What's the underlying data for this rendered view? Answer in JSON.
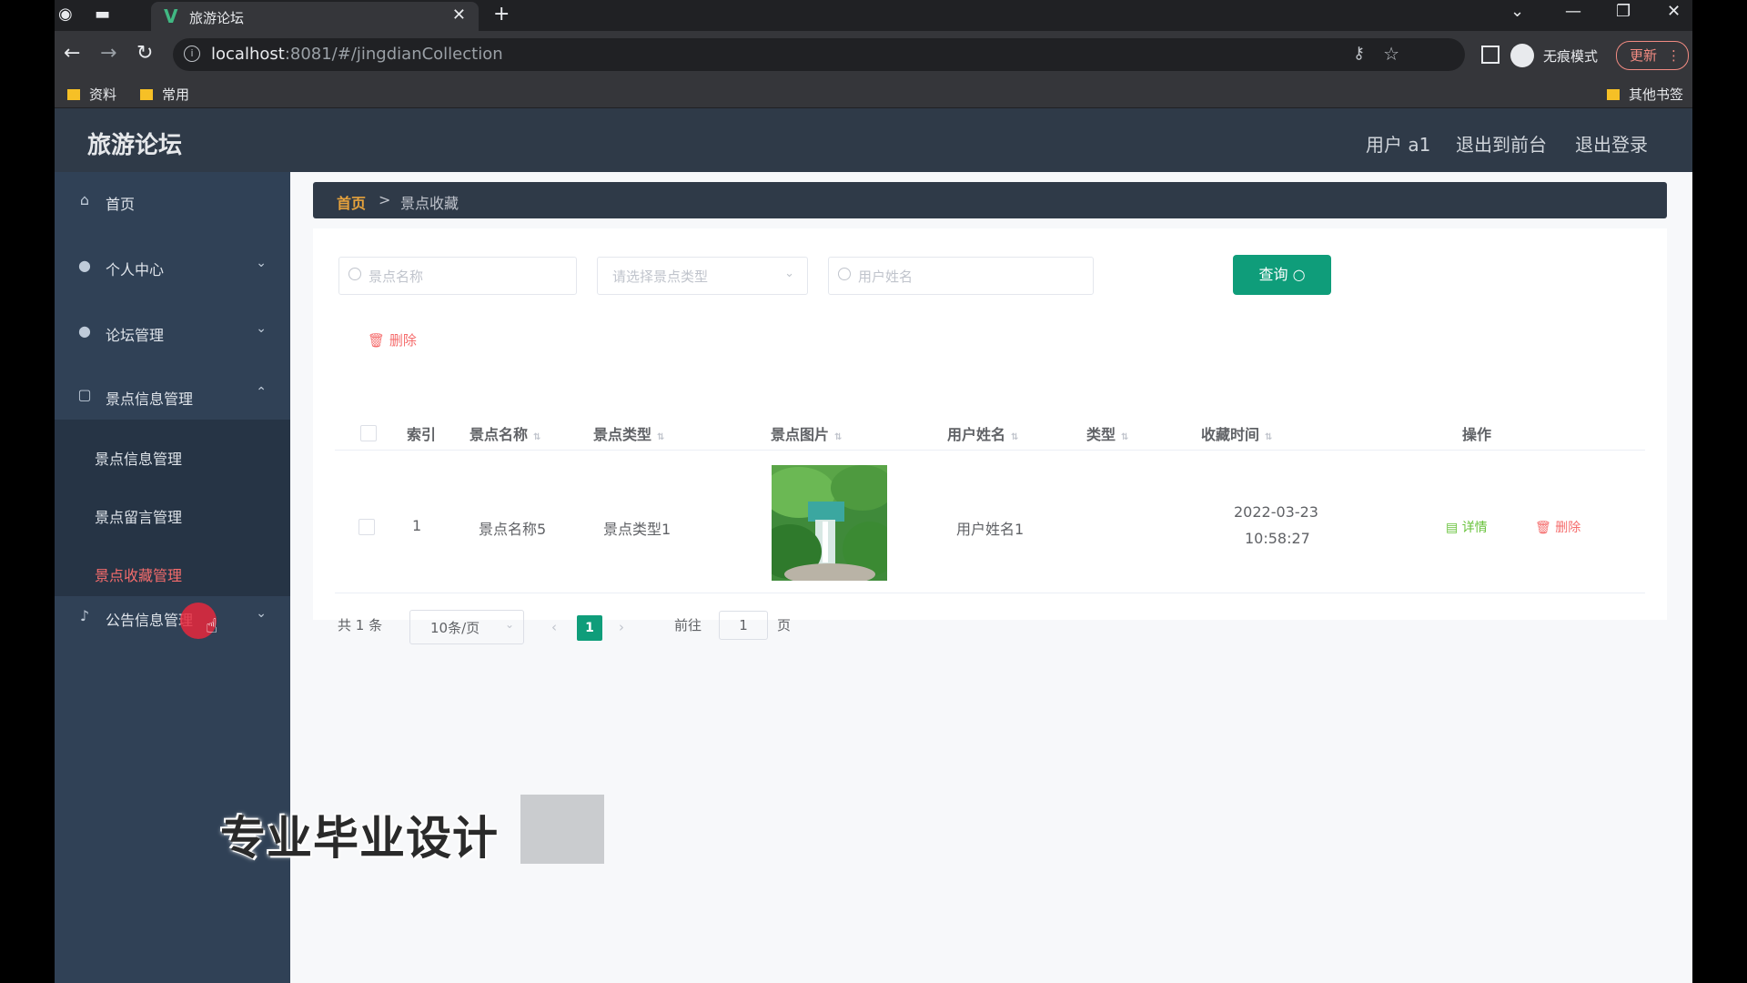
{
  "browser": {
    "tab_title": "旅游论坛",
    "url_host": "localhost",
    "url_rest": ":8081/#/jingdianCollection",
    "incognito_label": "无痕模式",
    "update_label": "更新",
    "bookmarks": [
      "资料",
      "常用"
    ],
    "other_bookmarks": "其他书签"
  },
  "app": {
    "title": "旅游论坛",
    "header_links": [
      "用户 a1",
      "退出到前台",
      "退出登录"
    ]
  },
  "sidebar": {
    "items": [
      {
        "label": "首页",
        "icon": "home-icon"
      },
      {
        "label": "个人中心",
        "icon": "user-icon"
      },
      {
        "label": "论坛管理",
        "icon": "user-icon"
      },
      {
        "label": "景点信息管理",
        "icon": "document-icon"
      },
      {
        "label": "公告信息管理",
        "icon": "microphone-icon"
      }
    ],
    "sub_items": [
      "景点信息管理",
      "景点留言管理",
      "景点收藏管理"
    ],
    "active_sub": "景点收藏管理"
  },
  "breadcrumb": {
    "home": "首页",
    "sep": ">",
    "current": "景点收藏"
  },
  "search": {
    "name_placeholder": "景点名称",
    "type_placeholder": "请选择景点类型",
    "user_placeholder": "用户姓名",
    "query_label": "查询"
  },
  "toolbar": {
    "delete_label": "删除"
  },
  "table": {
    "headers": [
      "索引",
      "景点名称",
      "景点类型",
      "景点图片",
      "用户姓名",
      "类型",
      "收藏时间",
      "操作"
    ],
    "rows": [
      {
        "index": "1",
        "name": "景点名称5",
        "type": "景点类型1",
        "user": "用户姓名1",
        "kind": "",
        "date": "2022-03-23",
        "time": "10:58:27",
        "detail": "详情",
        "delete": "删除"
      }
    ]
  },
  "pagination": {
    "total": "共 1 条",
    "page_size": "10条/页",
    "current": "1",
    "goto_prefix": "前往",
    "goto_value": "1",
    "goto_suffix": "页"
  },
  "overlay": {
    "watermark": "专业毕业设计"
  },
  "colors": {
    "accent": "#0f9d7a",
    "danger": "#f56c6c",
    "success": "#67c23a",
    "header": "#2f3a48",
    "sidebar": "#304156"
  }
}
